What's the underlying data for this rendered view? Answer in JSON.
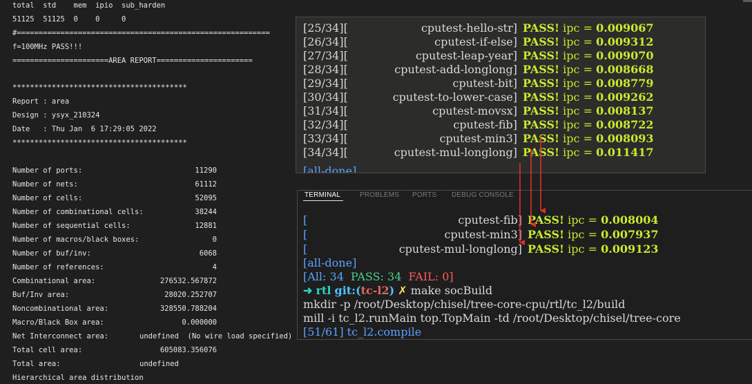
{
  "left": {
    "header_cols": "total  std    mem  ipio  sub_harden",
    "header_vals": "51125  51125  0    0     0",
    "hash_line": "#==========================================================",
    "freq": "f=100MHz PASS!!!",
    "area_report": "======================AREA REPORT======================",
    "stars1": "****************************************",
    "report": "Report : area",
    "design": "Design : ysyx_210324",
    "date": "Date   : Thu Jan  6 17:29:05 2022",
    "stars2": "****************************************",
    "stats": [
      {
        "label": "Number of ports:",
        "value": "11290"
      },
      {
        "label": "Number of nets:",
        "value": "61112"
      },
      {
        "label": "Number of cells:",
        "value": "52095"
      },
      {
        "label": "Number of combinational cells:",
        "value": "38244"
      },
      {
        "label": "Number of sequential cells:",
        "value": "12881"
      },
      {
        "label": "Number of macros/black boxes:",
        "value": "0"
      },
      {
        "label": "Number of buf/inv:",
        "value": "6068"
      },
      {
        "label": "Number of references:",
        "value": "4"
      },
      {
        "label": "Combinational area:",
        "value": "276532.567872"
      },
      {
        "label": "Buf/Inv area:",
        "value": "28020.252707"
      },
      {
        "label": "Noncombinational area:",
        "value": "328550.788204"
      },
      {
        "label": "Macro/Black Box area:",
        "value": "0.000000"
      }
    ],
    "net_label": "Net Interconnect area:",
    "net_value": "undefined  (No wire load specified)",
    "total_cell_label": "Total cell area:",
    "total_cell_value": "605083.356076",
    "total_area_label": "Total area:",
    "total_area_value": "undefined",
    "hier": "Hierarchical area distribution"
  },
  "tests": [
    {
      "idx": "[25/34][",
      "name": "cputest-hello-str]",
      "ipc": "0.009067"
    },
    {
      "idx": "[26/34][",
      "name": "cputest-if-else]",
      "ipc": "0.009312"
    },
    {
      "idx": "[27/34][",
      "name": "cputest-leap-year]",
      "ipc": "0.009070"
    },
    {
      "idx": "[28/34][",
      "name": "cputest-add-longlong]",
      "ipc": "0.008668"
    },
    {
      "idx": "[29/34][",
      "name": "cputest-bit]",
      "ipc": "0.008779"
    },
    {
      "idx": "[30/34][",
      "name": "cputest-to-lower-case]",
      "ipc": "0.009262"
    },
    {
      "idx": "[31/34][",
      "name": "cputest-movsx]",
      "ipc": "0.008137"
    },
    {
      "idx": "[32/34][",
      "name": "cputest-fib]",
      "ipc": "0.008722"
    },
    {
      "idx": "[33/34][",
      "name": "cputest-min3]",
      "ipc": "0.008093"
    },
    {
      "idx": "[34/34][",
      "name": "cputest-mul-longlong]",
      "ipc": "0.011417"
    }
  ],
  "tests_cut": "[all-done]",
  "pass_label": "PASS!",
  "ipc_label": "ipc =",
  "terminal": {
    "tabs": [
      "TERMINAL",
      "PROBLEMS",
      "PORTS",
      "DEBUG CONSOLE"
    ],
    "rows": [
      {
        "idx": "[",
        "name": "cputest-fib]",
        "ipc": "0.008004"
      },
      {
        "idx": "[",
        "name": "cputest-min3]",
        "ipc": "0.007937"
      },
      {
        "idx": "[",
        "name": "cputest-mul-longlong]",
        "ipc": "0.009123"
      }
    ],
    "all_done": "[all-done]",
    "summary_all": "[All: 34",
    "summary_pass": "PASS: 34",
    "summary_fail": "FAIL: 0]",
    "prompt_arrow": "➜",
    "prompt_dir": "rtl",
    "prompt_git": "git:(",
    "prompt_branch": "tc-l2",
    "prompt_git_close": ")",
    "prompt_x": "✗",
    "command": "make socBuild",
    "out1": "mkdir -p /root/Desktop/chisel/tree-core-cpu/rtl/tc_l2/build",
    "out2": "mill -i tc_l2.runMain top.TopMain -td /root/Desktop/chisel/tree-core",
    "out3": "[51/61] tc_l2.compile"
  },
  "colors": {
    "pass": "#c8ea2e",
    "arrow": "#e0302a",
    "prompt": "#2ad3c2",
    "branch": "#e06666",
    "fail": "#ff5c5c"
  }
}
